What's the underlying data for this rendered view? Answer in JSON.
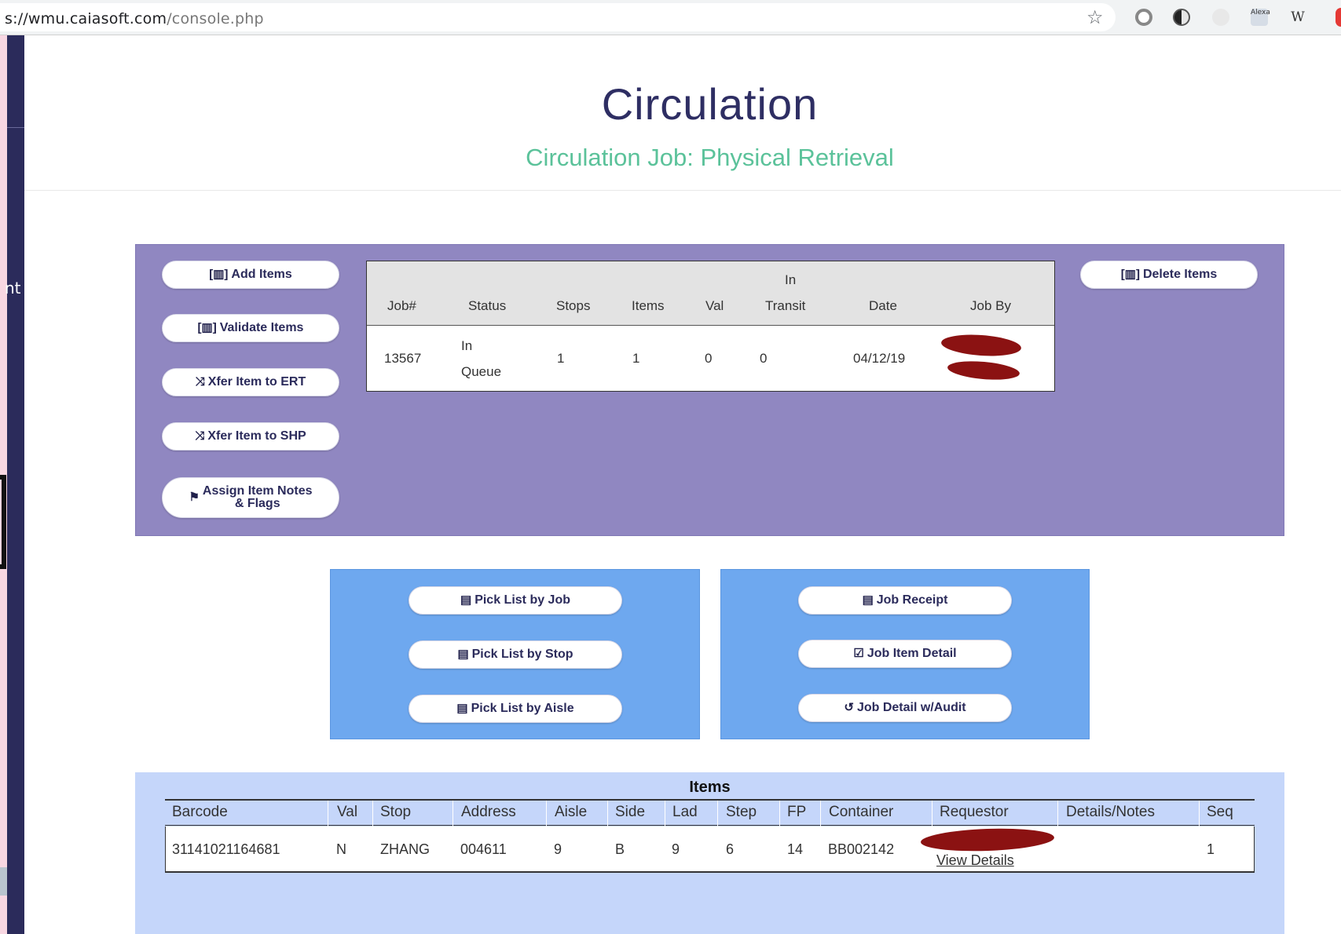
{
  "browser": {
    "url_host": "s://wmu.caiasoft.com",
    "url_path": "/console.php",
    "ext_alexa": "Alexa",
    "ext_w": "W"
  },
  "left_nav": {
    "partial_label": "nt"
  },
  "header": {
    "title": "Circulation",
    "subtitle": "Circulation Job: Physical Retrieval"
  },
  "actions_left": [
    {
      "label": "Add Items",
      "icon": "barcode-icon"
    },
    {
      "label": "Validate Items",
      "icon": "barcode-icon"
    },
    {
      "label": "Xfer Item to ERT",
      "icon": "shuffle-icon"
    },
    {
      "label": "Xfer Item to SHP",
      "icon": "shuffle-icon"
    },
    {
      "label_line1": "Assign Item Notes",
      "label_line2": "& Flags",
      "icon": "flag-icon"
    }
  ],
  "actions_right": [
    {
      "label": "Delete Items",
      "icon": "barcode-icon"
    }
  ],
  "job_table": {
    "headers": [
      "Job#",
      "Status",
      "Stops",
      "Items",
      "Val",
      "In",
      "Transit",
      "Date",
      "Job By"
    ],
    "row": {
      "job": "13567",
      "status_line1": "In",
      "status_line2": "Queue",
      "stops": "1",
      "items": "1",
      "val": "0",
      "in_transit": "0",
      "date": "04/12/19"
    }
  },
  "reports_left": [
    {
      "label": "Pick List by Job",
      "icon": "pdf-icon"
    },
    {
      "label": "Pick List by Stop",
      "icon": "pdf-icon"
    },
    {
      "label": "Pick List by Aisle",
      "icon": "pdf-icon"
    }
  ],
  "reports_right": [
    {
      "label": "Job Receipt",
      "icon": "pdf-icon"
    },
    {
      "label": "Job Item Detail",
      "icon": "clipboard-icon"
    },
    {
      "label": "Job Detail w/Audit",
      "icon": "history-icon"
    }
  ],
  "items": {
    "title": "Items",
    "headers": [
      "Barcode",
      "Val",
      "Stop",
      "Address",
      "Aisle",
      "Side",
      "Lad",
      "Step",
      "FP",
      "Container",
      "Requestor",
      "Details/Notes",
      "Seq"
    ],
    "row": {
      "barcode": "31141021164681",
      "val": "N",
      "stop": "ZHANG",
      "address": "004611",
      "aisle": "9",
      "side": "B",
      "lad": "9",
      "step": "6",
      "fp": "14",
      "container": "BB002142",
      "requestor_link": "View Details",
      "details": "",
      "seq": "1"
    }
  },
  "colors": {
    "purple_panel": "#9087c1",
    "blue_panel": "#6ea8ef",
    "items_panel": "#c5d6fa",
    "title": "#2e2e63",
    "subtitle": "#5bc29a",
    "redaction": "#8b1212"
  }
}
